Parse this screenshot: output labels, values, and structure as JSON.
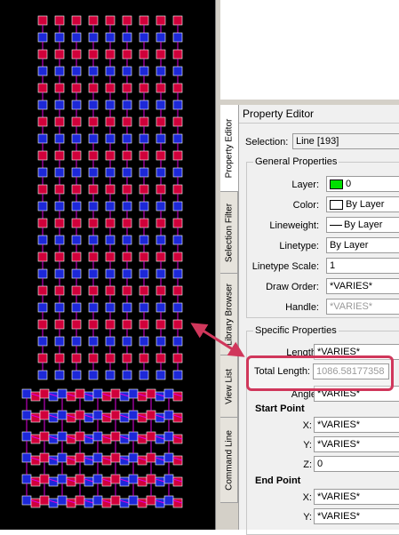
{
  "panel": {
    "title": "Property Editor",
    "selection_label": "Selection:",
    "selection_value": "Line [193]",
    "general_label": "General Properties",
    "layer": {
      "label": "Layer:",
      "value": "0",
      "swatch_color": "#00e000"
    },
    "color": {
      "label": "Color:",
      "value": "By Layer"
    },
    "lineweight": {
      "label": "Lineweight:",
      "value": "By Layer"
    },
    "linetype": {
      "label": "Linetype:",
      "value": "By Layer"
    },
    "linetype_scale": {
      "label": "Linetype Scale:",
      "value": "1"
    },
    "draw_order": {
      "label": "Draw Order:",
      "value": "*VARIES*"
    },
    "handle": {
      "label": "Handle:",
      "value": "*VARIES*"
    },
    "specific_label": "Specific Properties",
    "length": {
      "label": "Length:",
      "value": "*VARIES*"
    },
    "total_length": {
      "label": "Total Length:",
      "value": "1086.58177358"
    },
    "angle": {
      "label": "Angle:",
      "value": "*VARIES*"
    },
    "start_point": {
      "label": "Start Point",
      "x_label": "X:",
      "x": "*VARIES*",
      "y_label": "Y:",
      "y": "*VARIES*",
      "z_label": "Z:",
      "z": "0"
    },
    "end_point": {
      "label": "End Point",
      "x_label": "X:",
      "x": "*VARIES*",
      "y_label": "Y:",
      "y": "*VARIES*"
    }
  },
  "tabs": [
    "Property Editor",
    "Selection Filter",
    "Library Browser",
    "View List",
    "Command Line"
  ],
  "colors": {
    "red": "#d0003a",
    "blue": "#1c28d8",
    "magenta": "#e000e0",
    "highlight": "#d0375b"
  }
}
